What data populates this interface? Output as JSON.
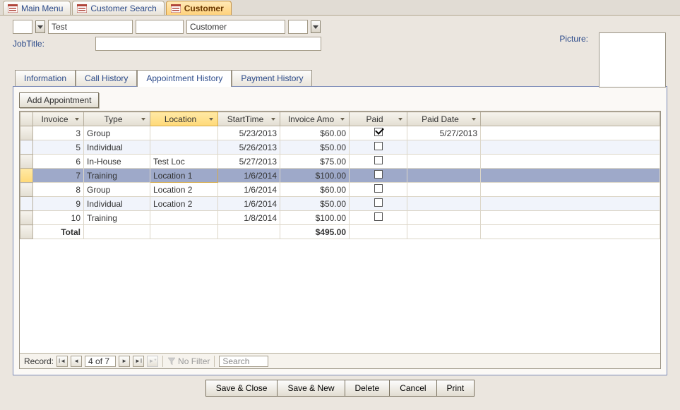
{
  "window_tabs": {
    "tab1": "Main Menu",
    "tab2": "Customer Search",
    "tab3": "Customer"
  },
  "header": {
    "first_name": "Test",
    "last_name": "Customer",
    "jobtitle_label": "JobTitle:",
    "picture_label": "Picture:"
  },
  "content_tabs": {
    "info": "Information",
    "calls": "Call History",
    "appointments": "Appointment History",
    "payments": "Payment History"
  },
  "add_appointment_label": "Add Appointment",
  "columns": {
    "invoice": "Invoice",
    "type": "Type",
    "location": "Location",
    "start": "StartTime",
    "amount": "Invoice Amo",
    "paid": "Paid",
    "paiddate": "Paid Date"
  },
  "rows": [
    {
      "invoice": "3",
      "type": "Group",
      "location": "",
      "start": "5/23/2013",
      "amount": "$60.00",
      "paid": true,
      "paiddate": "5/27/2013"
    },
    {
      "invoice": "5",
      "type": "Individual",
      "location": "",
      "start": "5/26/2013",
      "amount": "$50.00",
      "paid": false,
      "paiddate": ""
    },
    {
      "invoice": "6",
      "type": "In-House",
      "location": "Test Loc",
      "start": "5/27/2013",
      "amount": "$75.00",
      "paid": false,
      "paiddate": ""
    },
    {
      "invoice": "7",
      "type": "Training",
      "location": "Location 1",
      "start": "1/6/2014",
      "amount": "$100.00",
      "paid": false,
      "paiddate": ""
    },
    {
      "invoice": "8",
      "type": "Group",
      "location": "Location 2",
      "start": "1/6/2014",
      "amount": "$60.00",
      "paid": false,
      "paiddate": ""
    },
    {
      "invoice": "9",
      "type": "Individual",
      "location": "Location 2",
      "start": "1/6/2014",
      "amount": "$50.00",
      "paid": false,
      "paiddate": ""
    },
    {
      "invoice": "10",
      "type": "Training",
      "location": "",
      "start": "1/8/2014",
      "amount": "$100.00",
      "paid": false,
      "paiddate": ""
    }
  ],
  "total": {
    "label": "Total",
    "amount": "$495.00"
  },
  "record_nav": {
    "label": "Record:",
    "position": "4 of 7",
    "nofilter": "No Filter",
    "search_placeholder": "Search"
  },
  "actions": {
    "save_close": "Save & Close",
    "save_new": "Save & New",
    "delete": "Delete",
    "cancel": "Cancel",
    "print": "Print"
  }
}
